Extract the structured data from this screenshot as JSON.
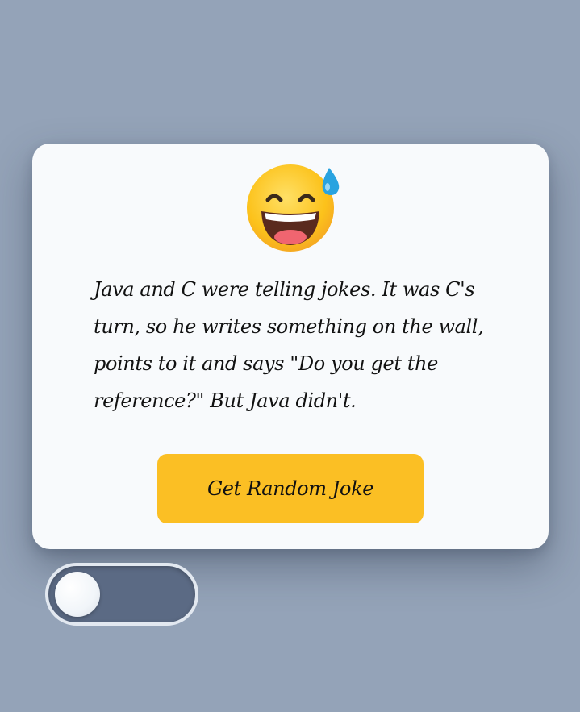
{
  "card": {
    "emoji": "grinning-face-with-sweat-emoji",
    "joke": "Java and C were telling jokes. It was C's turn, so he writes something on the wall, points to it and says \"Do you get the reference?\" But Java didn't.",
    "button_label": "Get Random Joke"
  },
  "toggle": {
    "state": "off"
  },
  "colors": {
    "background": "#94a3b8",
    "card": "#f8fafc",
    "button": "#fbbf24",
    "toggle_track": "#5b6a84"
  }
}
